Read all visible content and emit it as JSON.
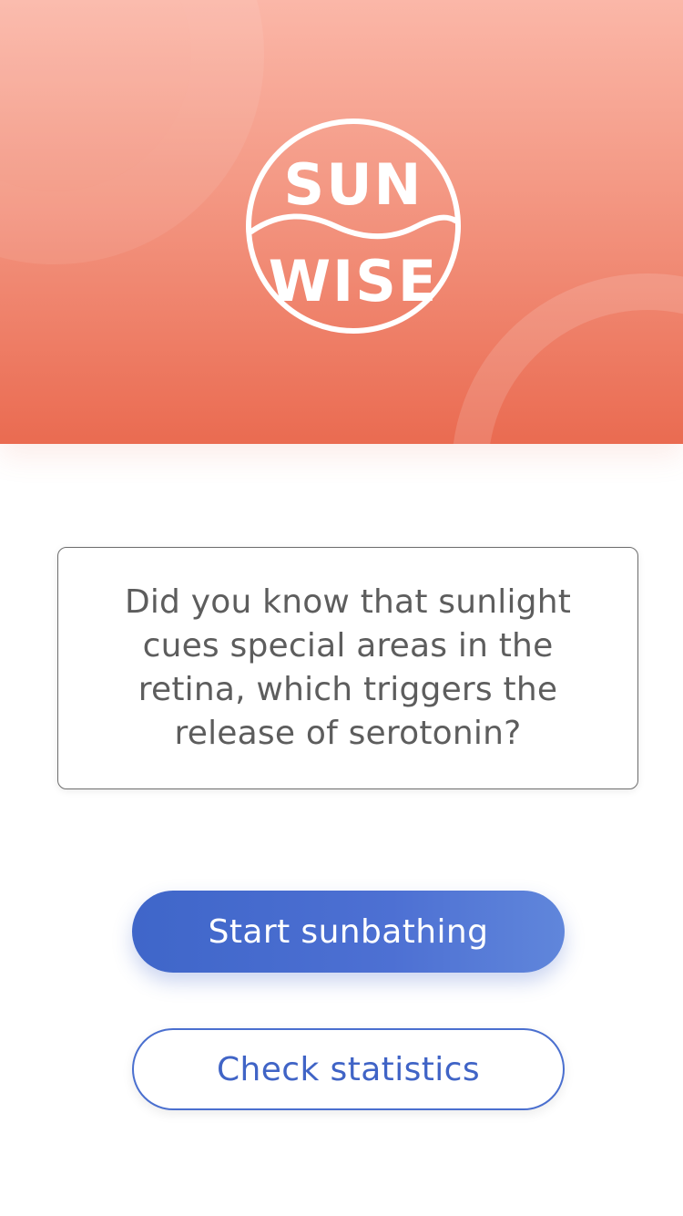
{
  "app": {
    "logo_text_top": "SUN",
    "logo_text_bottom": "WISE",
    "logo_icon": "sun-wise-logo-icon"
  },
  "fact": {
    "text": "Did you know that sunlight cues special areas in the retina, which triggers the release of serotonin?"
  },
  "actions": {
    "start_label": "Start sunbathing",
    "stats_label": "Check statistics"
  },
  "colors": {
    "hero_top": "#fbb7a8",
    "hero_bottom": "#ea6b51",
    "primary_blue": "#4366c8",
    "text_gray": "#5d5d5d"
  }
}
